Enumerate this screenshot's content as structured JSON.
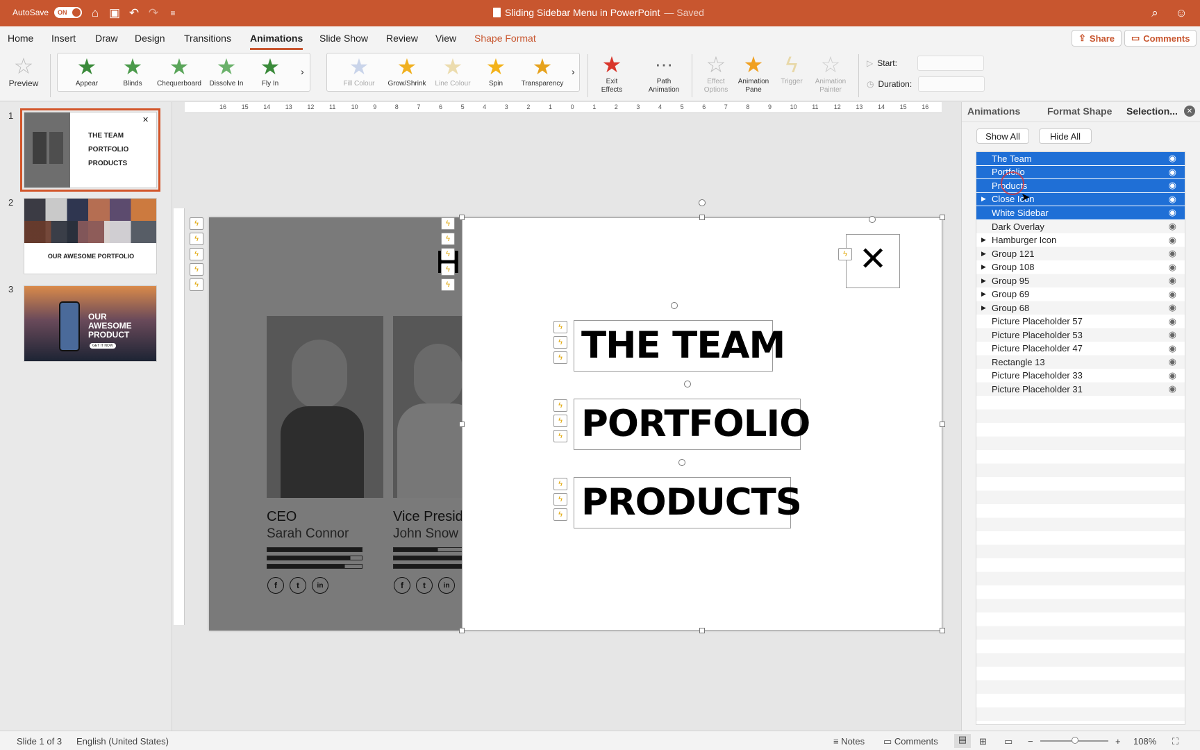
{
  "titlebar": {
    "autosave_label": "AutoSave",
    "autosave_state": "ON",
    "doc_title": "Sliding Sidebar Menu in PowerPoint",
    "saved_state": "— Saved"
  },
  "tabs": [
    "Home",
    "Insert",
    "Draw",
    "Design",
    "Transitions",
    "Animations",
    "Slide Show",
    "Review",
    "View",
    "Shape Format"
  ],
  "active_tab": "Animations",
  "share_label": "Share",
  "comments_label": "Comments",
  "ribbon": {
    "preview": "Preview",
    "entrance": [
      "Appear",
      "Blinds",
      "Chequerboard",
      "Dissolve In",
      "Fly In"
    ],
    "emphasis": [
      "Fill Colour",
      "Grow/Shrink",
      "Line Colour",
      "Spin",
      "Transparency"
    ],
    "exit_effects": "Exit Effects",
    "path_animation": "Path Animation",
    "effect_options": "Effect Options",
    "animation_pane": "Animation Pane",
    "trigger": "Trigger",
    "animation_painter": "Animation Painter",
    "start_label": "Start:",
    "duration_label": "Duration:"
  },
  "thumbnails": [
    {
      "num": "1",
      "lines": [
        "THE TEAM",
        "PORTFOLIO",
        "PRODUCTS"
      ]
    },
    {
      "num": "2",
      "title": "OUR AWESOME PORTFOLIO"
    },
    {
      "num": "3",
      "title": "OUR AWESOME PRODUCT",
      "btn": "GET IT NOW"
    }
  ],
  "ruler_ticks": [
    "16",
    "15",
    "14",
    "13",
    "12",
    "11",
    "10",
    "9",
    "8",
    "7",
    "6",
    "5",
    "4",
    "3",
    "2",
    "1",
    "0",
    "1",
    "2",
    "3",
    "4",
    "5",
    "6",
    "7",
    "8",
    "9",
    "10",
    "11",
    "12",
    "13",
    "14",
    "15",
    "16"
  ],
  "slide": {
    "letter_partial": "H",
    "people": [
      {
        "role": "CEO",
        "name": "Sarah Connor"
      },
      {
        "role": "Vice Presid",
        "name": "John Snow"
      }
    ],
    "social": [
      "f",
      "t",
      "in"
    ],
    "menu": [
      "THE TEAM",
      "PORTFOLIO",
      "PRODUCTS"
    ]
  },
  "pane": {
    "tabs": [
      "Animations",
      "Format Shape",
      "Selection..."
    ],
    "show_all": "Show All",
    "hide_all": "Hide All",
    "items": [
      {
        "label": "The Team",
        "selected": true,
        "group": false
      },
      {
        "label": "Portfolio",
        "selected": true,
        "group": false
      },
      {
        "label": "Products",
        "selected": true,
        "group": false
      },
      {
        "label": "Close Icon",
        "selected": true,
        "group": true
      },
      {
        "label": "White Sidebar",
        "selected": true,
        "group": false
      },
      {
        "label": "Dark Overlay",
        "selected": false,
        "group": false
      },
      {
        "label": "Hamburger Icon",
        "selected": false,
        "group": true
      },
      {
        "label": "Group 121",
        "selected": false,
        "group": true
      },
      {
        "label": "Group 108",
        "selected": false,
        "group": true
      },
      {
        "label": "Group 95",
        "selected": false,
        "group": true
      },
      {
        "label": "Group 69",
        "selected": false,
        "group": true
      },
      {
        "label": "Group 68",
        "selected": false,
        "group": true
      },
      {
        "label": "Picture Placeholder 57",
        "selected": false,
        "group": false
      },
      {
        "label": "Picture Placeholder 53",
        "selected": false,
        "group": false
      },
      {
        "label": "Picture Placeholder 47",
        "selected": false,
        "group": false
      },
      {
        "label": "Rectangle 13",
        "selected": false,
        "group": false
      },
      {
        "label": "Picture Placeholder 33",
        "selected": false,
        "group": false
      },
      {
        "label": "Picture Placeholder 31",
        "selected": false,
        "group": false
      }
    ]
  },
  "status": {
    "slide_info": "Slide 1 of 3",
    "language": "English (United States)",
    "notes": "Notes",
    "comments": "Comments",
    "zoom": "108%"
  },
  "colors": {
    "accent": "#c8562f",
    "selection": "#1f6fd6",
    "overlay": "#7a7a7a"
  }
}
